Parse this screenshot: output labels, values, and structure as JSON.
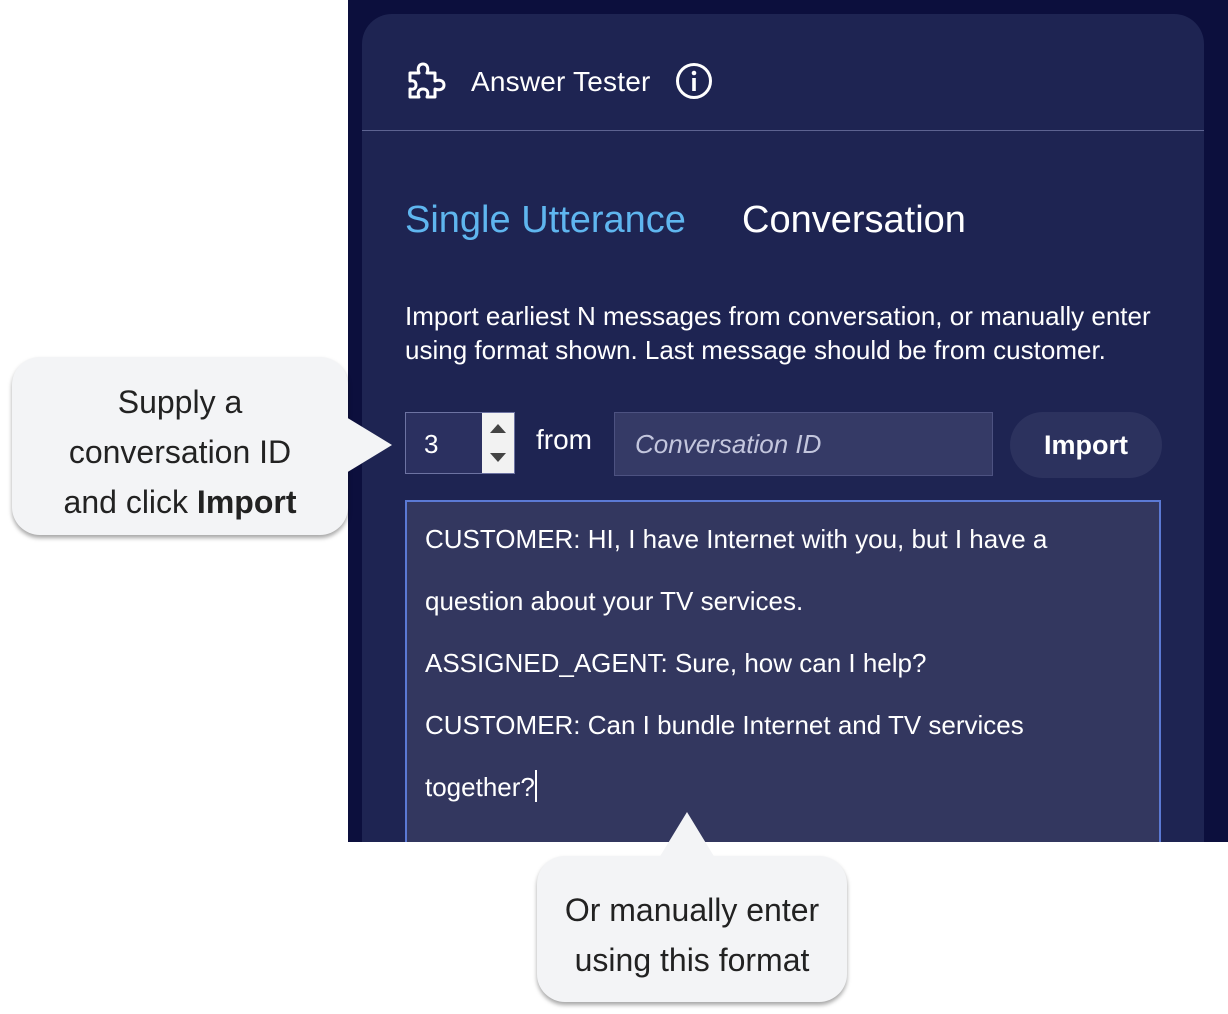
{
  "header": {
    "title": "Answer Tester",
    "puzzle_icon": "puzzle-piece-icon",
    "info_icon": "info-icon"
  },
  "tabs": [
    {
      "label": "Single Utterance",
      "active": true
    },
    {
      "label": "Conversation",
      "active": false
    }
  ],
  "colors": {
    "active_tab": "#5fb6ef",
    "panel": "#1e2452",
    "textarea_border": "#5b79d4"
  },
  "instructions": "Import earliest N messages from conversation, or manually enter using format shown. Last message should be from customer.",
  "import_row": {
    "count": "3",
    "from_label": "from",
    "conversation_placeholder": "Conversation ID",
    "import_label": "Import"
  },
  "messages": [
    "CUSTOMER: HI, I have Internet with you, but I have a",
    "question about your TV services.",
    "ASSIGNED_AGENT: Sure, how can I help?",
    "CUSTOMER: Can I bundle Internet and TV services",
    "together?"
  ],
  "callouts": {
    "left": {
      "line1": "Supply a",
      "line2": "conversation ID",
      "line3_prefix": "and click ",
      "line3_bold": "Import"
    },
    "bottom": {
      "line1": "Or manually enter",
      "line2": "using this format"
    }
  }
}
